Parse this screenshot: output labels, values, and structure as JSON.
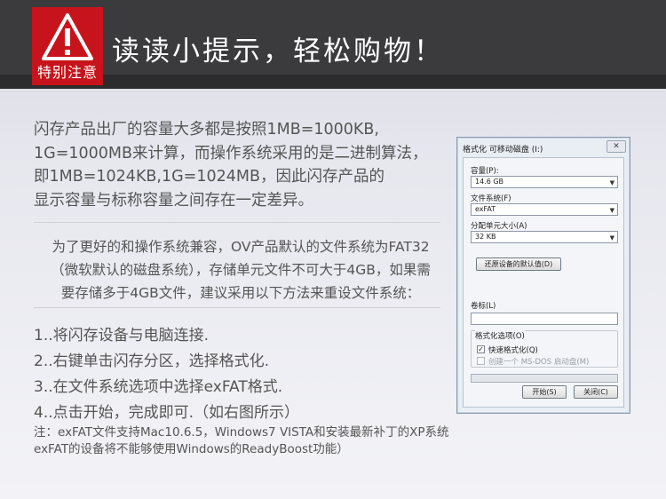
{
  "header": {
    "badge_label": "特别注意",
    "title": "读读小提示，轻松购物！"
  },
  "intro_lines": [
    "闪存产品出厂的容量大多都是按照1MB=1000KB,",
    "1G=1000MB来计算，而操作系统采用的是二进制算法，",
    "即1MB=1024KB,1G=1024MB，因此闪存产品的",
    "显示容量与标称容量之间存在一定差异。"
  ],
  "note_lines": [
    "为了更好的和操作系统兼容，OV产品默认的文件系统为FAT32",
    "（微软默认的磁盘系统），存储单元文件不可大于4GB，如果需",
    "要存储多于4GB文件，建议采用以下方法来重设文件系统："
  ],
  "steps": [
    "1..将闪存设备与电脑连接.",
    "2..右键单击闪存分区，选择格式化.",
    "3..在文件系统选项中选择exFAT格式.",
    "4..点击开始，完成即可.（如右图所示）"
  ],
  "footnote_lines": [
    "注：exFAT文件支持Mac10.6.5，Windows7  VISTA和安装最新补丁的XP系统",
    "exFAT的设备将不能够使用Windows的ReadyBoost功能）"
  ],
  "dialog": {
    "title": "格式化 可移动磁盘 (I:)",
    "close": "✕",
    "capacity_label": "容量(P):",
    "capacity_value": "14.6 GB",
    "filesystem_label": "文件系统(F)",
    "filesystem_value": "exFAT",
    "alloc_label": "分配单元大小(A)",
    "alloc_value": "32 KB",
    "restore_button": "还原设备的默认值(D)",
    "volume_label": "卷标(L)",
    "volume_value": "",
    "options_label": "格式化选项(O)",
    "quick_format": "快速格式化(Q)",
    "quick_format_checked": true,
    "msdos_disk": "创建一个 MS-DOS 启动盘(M)",
    "msdos_checked": false,
    "start_button": "开始(S)",
    "close_button": "关闭(C)"
  },
  "colors": {
    "header_bg": "#3b3b3d",
    "badge_red": "#c7141c",
    "body_text": "#555555"
  }
}
